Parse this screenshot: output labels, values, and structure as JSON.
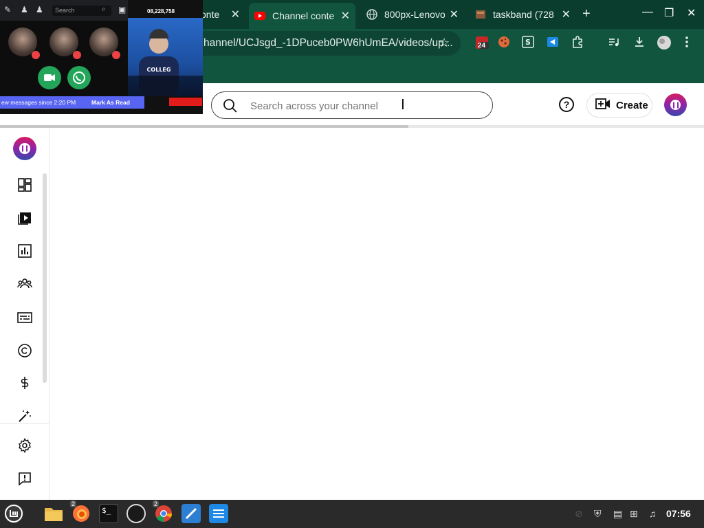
{
  "browser": {
    "tabs": [
      {
        "title": "conte",
        "active": false
      },
      {
        "title": "Channel conte",
        "active": true
      },
      {
        "title": "800px-Lenovo",
        "active": false
      },
      {
        "title": "taskband (728",
        "active": false
      }
    ],
    "url": "hannel/UCJsgd_-1DPuceb0PW6hUmEA/videos/up...",
    "extension_badge": "24"
  },
  "header": {
    "search_placeholder": "Search across your channel",
    "create_label": "Create",
    "help_glyph": "?"
  },
  "sidebar": {
    "items": [
      {
        "name": "dashboard-icon"
      },
      {
        "name": "content-icon"
      },
      {
        "name": "analytics-icon"
      },
      {
        "name": "community-icon"
      },
      {
        "name": "subtitles-icon"
      },
      {
        "name": "copyright-icon"
      },
      {
        "name": "earn-icon"
      },
      {
        "name": "customization-icon"
      },
      {
        "name": "settings-icon"
      },
      {
        "name": "feedback-icon"
      }
    ]
  },
  "overlay": {
    "search_placeholder": "Search",
    "banner_text": "ew messages since 2:20 PM",
    "banner_action": "Mark As Read",
    "viewer_count": "08,228,758"
  },
  "taskbar": {
    "badges": {
      "firefox": "2",
      "chrome": "2"
    },
    "clock": "07:56"
  },
  "colors": {
    "chrome_dark": "#0b3d2e",
    "chrome_light": "#12553f",
    "taskbar": "#2a2a2a",
    "discord_blurple": "#5865f2"
  }
}
